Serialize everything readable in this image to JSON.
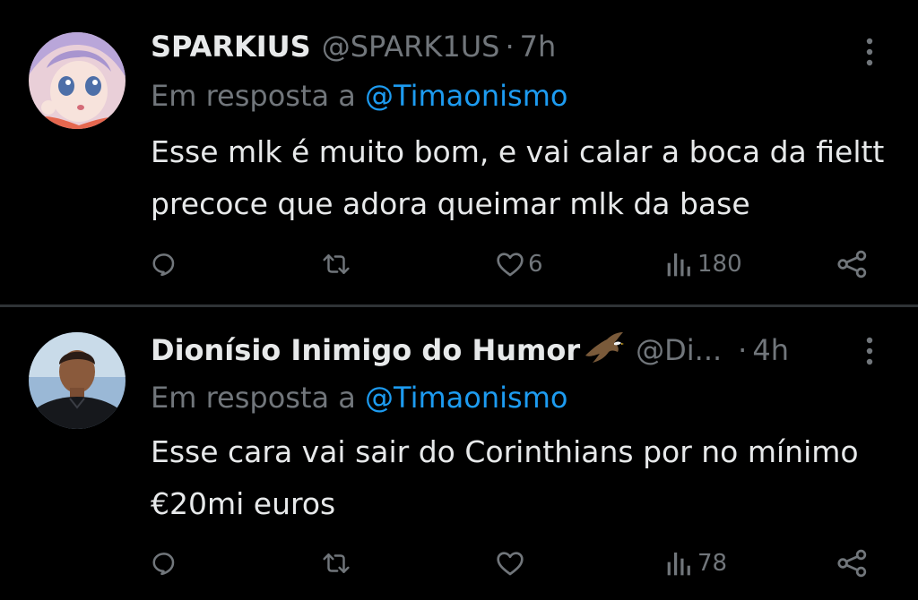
{
  "tweets": [
    {
      "display_name": "SPARKIUS",
      "handle": "@SPARK1US",
      "separator": "·",
      "time": "7h",
      "reply_prefix": "Em resposta a",
      "reply_to": "@Timaonismo",
      "text": "Esse mlk é muito bom, e vai calar a boca da fieltt precoce que adora queimar mlk da base",
      "likes": "6",
      "views": "180"
    },
    {
      "display_name": "Dionísio Inimigo do Humor",
      "handle": "@Di...",
      "separator": "·",
      "time": "4h",
      "reply_prefix": "Em resposta a",
      "reply_to": "@Timaonismo",
      "text": "Esse cara vai sair do Corinthians por no mínimo €20mi euros",
      "likes": "",
      "views": "78"
    }
  ],
  "icons": [
    "more-vertical-icon",
    "reply-icon",
    "retweet-icon",
    "like-icon",
    "views-icon",
    "share-icon",
    "eagle-emoji-icon"
  ],
  "colors": {
    "background": "#000000",
    "text": "#e7e9ea",
    "secondary": "#71767b",
    "mention": "#1d9bf0",
    "divider": "#2f3336"
  }
}
